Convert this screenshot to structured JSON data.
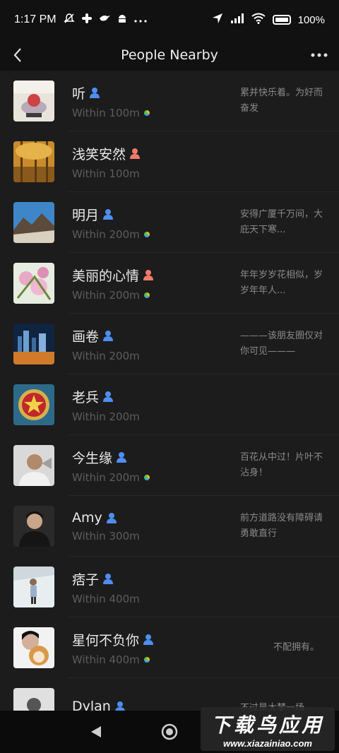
{
  "status_bar": {
    "time": "1:17 PM",
    "battery": "100%"
  },
  "header": {
    "title": "People Nearby"
  },
  "people": [
    {
      "name": "听",
      "gender": "male",
      "distance": "Within 100m",
      "has_moments": true,
      "signature": "累并快乐着。为好而奋发"
    },
    {
      "name": "浅笑安然",
      "gender": "female",
      "distance": "Within 100m",
      "has_moments": false,
      "signature": ""
    },
    {
      "name": "明月",
      "gender": "male",
      "distance": "Within 200m",
      "has_moments": true,
      "signature": "安得广厦千万间，大庇天下寒..."
    },
    {
      "name": "美丽的心情",
      "gender": "female",
      "distance": "Within 200m",
      "has_moments": true,
      "signature": "年年岁岁花相似，岁岁年年人..."
    },
    {
      "name": "画卷",
      "gender": "male",
      "distance": "Within 200m",
      "has_moments": false,
      "signature": "———该朋友圈仅对你可见———"
    },
    {
      "name": "老兵",
      "gender": "male",
      "distance": "Within 200m",
      "has_moments": false,
      "signature": ""
    },
    {
      "name": "今生缘",
      "gender": "male",
      "distance": "Within 200m",
      "has_moments": true,
      "signature": "百花从中过！片叶不沾身！"
    },
    {
      "name": "Amy",
      "gender": "male",
      "distance": "Within 300m",
      "has_moments": false,
      "signature": "前方道路没有障碍请勇敢直行"
    },
    {
      "name": "痞子",
      "gender": "male",
      "distance": "Within 400m",
      "has_moments": false,
      "signature": ""
    },
    {
      "name": "星何不负你",
      "gender": "male",
      "distance": "Within 400m",
      "has_moments": true,
      "signature": "不配拥有。"
    },
    {
      "name": "Dylan",
      "gender": "male",
      "distance": "",
      "has_moments": false,
      "signature": "不过是大梦一场"
    }
  ],
  "watermark": {
    "main": "下载鸟应用",
    "url": "www.xiazainiao.com"
  },
  "colors": {
    "male": "#4f8ef0",
    "female": "#f07a6a",
    "background": "#1c1c1c"
  }
}
